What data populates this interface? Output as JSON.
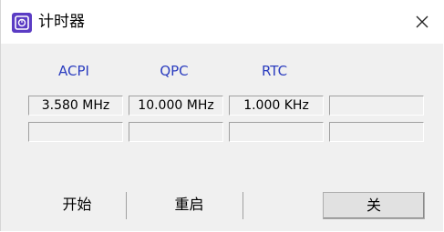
{
  "window": {
    "title": "计时器",
    "icon": "timer-app-icon",
    "close_icon": "close-icon"
  },
  "columns": [
    "ACPI",
    "QPC",
    "RTC",
    ""
  ],
  "rows": [
    [
      "3.580 MHz",
      "10.000 MHz",
      "1.000 KHz",
      ""
    ],
    [
      "",
      "",
      "",
      ""
    ]
  ],
  "buttons": {
    "start": "开始",
    "reset": "重启",
    "close": "关"
  },
  "colors": {
    "accent": "#2b3dbf",
    "icon_bg": "#5b3cc4"
  }
}
